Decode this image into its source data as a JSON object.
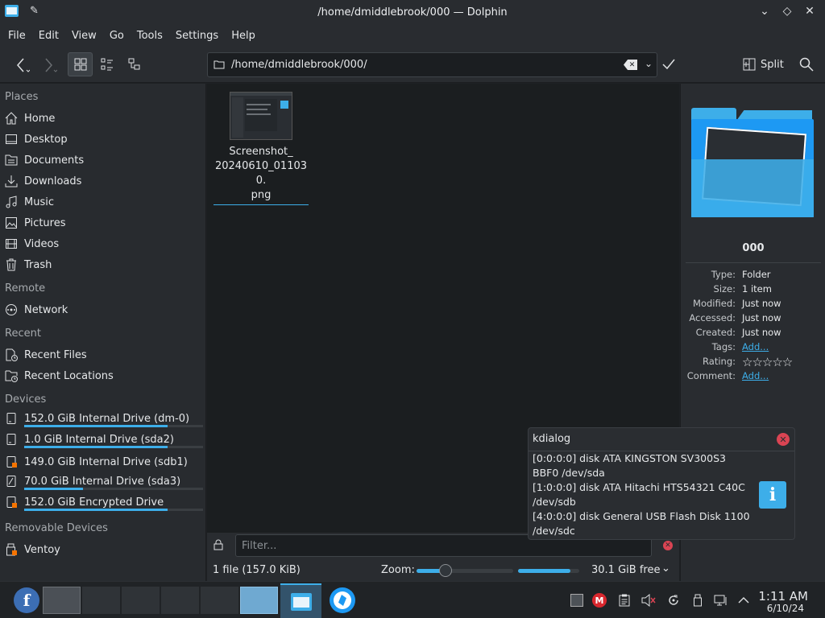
{
  "window": {
    "title": "/home/dmiddlebrook/000 — Dolphin"
  },
  "menu": [
    "File",
    "Edit",
    "View",
    "Go",
    "Tools",
    "Settings",
    "Help"
  ],
  "toolbar": {
    "path": "/home/dmiddlebrook/000/",
    "split_label": "Split"
  },
  "sidebar": {
    "places_title": "Places",
    "places": [
      {
        "label": "Home",
        "icon": "home-icon"
      },
      {
        "label": "Desktop",
        "icon": "desktop-icon"
      },
      {
        "label": "Documents",
        "icon": "documents-icon"
      },
      {
        "label": "Downloads",
        "icon": "downloads-icon"
      },
      {
        "label": "Music",
        "icon": "music-icon"
      },
      {
        "label": "Pictures",
        "icon": "pictures-icon"
      },
      {
        "label": "Videos",
        "icon": "videos-icon"
      },
      {
        "label": "Trash",
        "icon": "trash-icon"
      }
    ],
    "remote_title": "Remote",
    "remote": [
      {
        "label": "Network",
        "icon": "network-icon"
      }
    ],
    "recent_title": "Recent",
    "recent": [
      {
        "label": "Recent Files",
        "icon": "recent-files-icon"
      },
      {
        "label": "Recent Locations",
        "icon": "recent-locations-icon"
      }
    ],
    "devices_title": "Devices",
    "devices": [
      {
        "label": "152.0 GiB Internal Drive (dm-0)",
        "usage": 0.8
      },
      {
        "label": "1.0 GiB Internal Drive (sda2)",
        "usage": 0.8
      },
      {
        "label": "149.0 GiB Internal Drive (sdb1)",
        "usage": null
      },
      {
        "label": "70.0 GiB Internal Drive (sda3)",
        "usage": 0.33
      },
      {
        "label": "152.0 GiB Encrypted Drive",
        "usage": 0.8
      }
    ],
    "removable_title": "Removable Devices",
    "removable": [
      {
        "label": "Ventoy"
      }
    ]
  },
  "files": [
    {
      "name": "Screenshot_\n20240610_011030.\npng",
      "line1": "Screenshot_",
      "line2": "20240610_011030.",
      "line3": "png"
    }
  ],
  "filter": {
    "placeholder": "Filter..."
  },
  "status": {
    "count": "1 file (157.0 KiB)",
    "zoom_label": "Zoom:",
    "free": "30.1 GiB free",
    "zoom_level": 0.3,
    "free_ratio": 0.85
  },
  "info": {
    "name": "000",
    "rows": [
      {
        "key": "Type:",
        "value": "Folder"
      },
      {
        "key": "Size:",
        "value": "1 item"
      },
      {
        "key": "Modified:",
        "value": "Just now"
      },
      {
        "key": "Accessed:",
        "value": "Just now"
      },
      {
        "key": "Created:",
        "value": "Just now"
      },
      {
        "key": "Tags:",
        "value": "Add..."
      },
      {
        "key": "Rating:",
        "value": ""
      },
      {
        "key": "Comment:",
        "value": "Add..."
      }
    ]
  },
  "notification": {
    "title": "kdialog",
    "lines": [
      "[0:0:0:0] disk ATA KINGSTON SV300S3",
      "BBF0 /dev/sda",
      "[1:0:0:0] disk ATA Hitachi HTS54321 C40C",
      "/dev/sdb",
      "[4:0:0:0] disk General USB Flash Disk 1100",
      "/dev/sdc"
    ]
  },
  "clock": {
    "time": "1:11 AM",
    "date": "6/10/24"
  },
  "colors": {
    "accent": "#3daee9",
    "bg": "#1b1e20",
    "panel": "#292c30",
    "close": "#da4453"
  }
}
